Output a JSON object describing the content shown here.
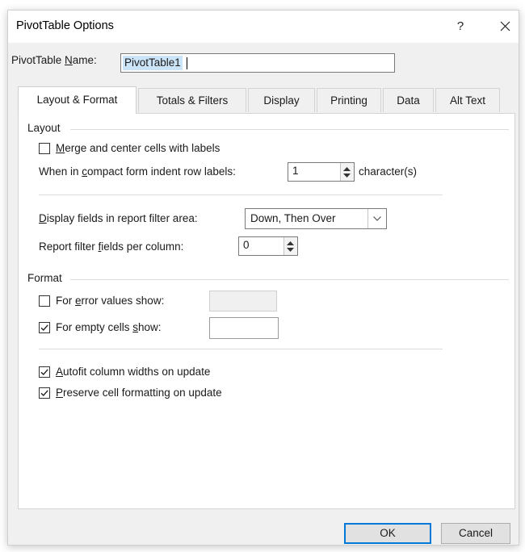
{
  "dialog": {
    "title": "PivotTable Options",
    "help_label": "?",
    "name_label_pre": "PivotTable ",
    "name_label_u": "N",
    "name_label_post": "ame:",
    "name_value": "PivotTable1"
  },
  "tabs": [
    {
      "label": "Layout & Format",
      "active": true
    },
    {
      "label": "Totals & Filters",
      "active": false
    },
    {
      "label": "Display",
      "active": false
    },
    {
      "label": "Printing",
      "active": false
    },
    {
      "label": "Data",
      "active": false
    },
    {
      "label": "Alt Text",
      "active": false
    }
  ],
  "layout_group": {
    "title": "Layout",
    "merge": {
      "pre": "",
      "u": "M",
      "post": "erge and center cells with labels",
      "checked": false
    },
    "indent": {
      "pre": "When in ",
      "u": "c",
      "post": "ompact form indent row labels:",
      "value": "1",
      "suffix": "character(s)"
    },
    "display_fields": {
      "pre": "",
      "u": "D",
      "post": "isplay fields in report filter area:",
      "value": "Down, Then Over"
    },
    "filter_fields": {
      "pre": "Report filter ",
      "u": "f",
      "post": "ields per column:",
      "value": "0"
    }
  },
  "format_group": {
    "title": "Format",
    "error_values": {
      "pre": "For ",
      "u": "e",
      "post": "rror values show:",
      "checked": false,
      "value": ""
    },
    "empty_cells": {
      "pre": "For empty cells ",
      "u": "s",
      "post": "how:",
      "checked": true,
      "value": ""
    },
    "autofit": {
      "pre": "",
      "u": "A",
      "post": "utofit column widths on update",
      "checked": true
    },
    "preserve": {
      "pre": "",
      "u": "P",
      "post": "reserve cell formatting on update",
      "checked": true
    }
  },
  "buttons": {
    "ok": "OK",
    "cancel": "Cancel"
  },
  "colors": {
    "accent": "#0078d7",
    "selection": "#cce4f7",
    "dialog_bg": "#f0f0f0"
  }
}
